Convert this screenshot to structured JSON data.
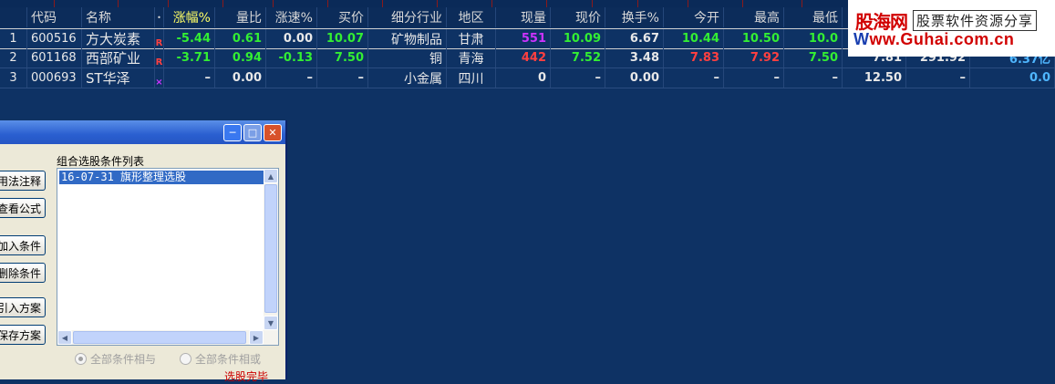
{
  "tabs": [
    "",
    "",
    "",
    "",
    "",
    "",
    "",
    "",
    "",
    "",
    "",
    "",
    "",
    "",
    "",
    "",
    "",
    "",
    ""
  ],
  "columns": [
    "",
    "代码",
    "名称",
    "•",
    "涨幅%",
    "量比",
    "涨速%",
    "买价",
    "细分行业",
    "地区",
    "现量",
    "现价",
    "换手%",
    "今开",
    "最高",
    "最低",
    "",
    "",
    ""
  ],
  "rows": [
    [
      "1",
      "600516",
      "方大炭素",
      "R",
      "-5.44",
      "0.61",
      "0.00",
      "10.07",
      "矿物制品",
      "甘肃",
      "551",
      "10.09",
      "6.67",
      "10.44",
      "10.50",
      "10.0",
      "",
      "",
      ""
    ],
    [
      "2",
      "601168",
      "西部矿业",
      "R",
      "-3.71",
      "0.94",
      "-0.13",
      "7.50",
      "铜",
      "青海",
      "442",
      "7.52",
      "3.48",
      "7.83",
      "7.92",
      "7.50",
      "7.81",
      "291.92",
      "6.37亿"
    ],
    [
      "3",
      "000693",
      "ST华泽",
      "×",
      "–",
      "0.00",
      "–",
      "–",
      "小金属",
      "四川",
      "0",
      "–",
      "0.00",
      "–",
      "–",
      "–",
      "12.50",
      "–",
      "0.0"
    ]
  ],
  "watermark": {
    "logo": "股海网",
    "slogan": "股票软件资源分享",
    "url_prefix": "W",
    "url_rest": "ww.Guhai.com.cn"
  },
  "dialog": {
    "list_label": "组合选股条件列表",
    "list_items": [
      "16-07-31 旗形整理选股"
    ],
    "buttons": [
      "用法注释",
      "查看公式",
      "加入条件",
      "删除条件",
      "引入方案",
      "保存方案"
    ],
    "radio_all_and": "全部条件相与",
    "radio_all_or": "全部条件相或",
    "status": "选股完毕"
  },
  "colors": {
    "background": "#0e3264",
    "up": "#ff4040",
    "down": "#33ee33",
    "volume": "#cc33ff",
    "neutral": "#e8e8e8"
  }
}
